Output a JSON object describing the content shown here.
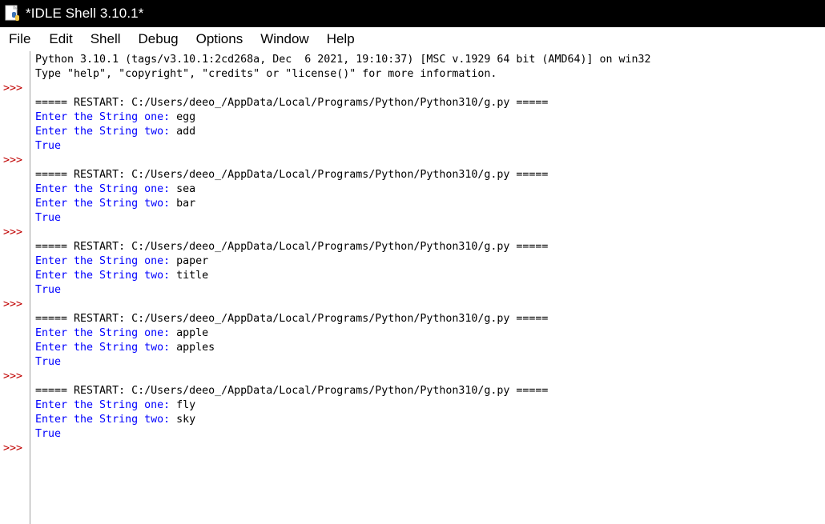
{
  "window": {
    "title": "*IDLE Shell 3.10.1*"
  },
  "menu": [
    "File",
    "Edit",
    "Shell",
    "Debug",
    "Options",
    "Window",
    "Help"
  ],
  "colors": {
    "prompt": "#c00000",
    "stdout": "#0000ff",
    "output": "#000000"
  },
  "shell": {
    "banner": [
      "Python 3.10.1 (tags/v3.10.1:2cd268a, Dec  6 2021, 19:10:37) [MSC v.1929 64 bit (AMD64)] on win32",
      "Type \"help\", \"copyright\", \"credits\" or \"license()\" for more information."
    ],
    "prompt": ">>>",
    "runs": [
      {
        "restart": "===== RESTART: C:/Users/deeo_/AppData/Local/Programs/Python/Python310/g.py =====",
        "prompt1": "Enter the String one: ",
        "input1": "egg",
        "prompt2": "Enter the String two: ",
        "input2": "add",
        "result": "True"
      },
      {
        "restart": "===== RESTART: C:/Users/deeo_/AppData/Local/Programs/Python/Python310/g.py =====",
        "prompt1": "Enter the String one: ",
        "input1": "sea",
        "prompt2": "Enter the String two: ",
        "input2": "bar",
        "result": "True"
      },
      {
        "restart": "===== RESTART: C:/Users/deeo_/AppData/Local/Programs/Python/Python310/g.py =====",
        "prompt1": "Enter the String one: ",
        "input1": "paper",
        "prompt2": "Enter the String two: ",
        "input2": "title",
        "result": "True"
      },
      {
        "restart": "===== RESTART: C:/Users/deeo_/AppData/Local/Programs/Python/Python310/g.py =====",
        "prompt1": "Enter the String one: ",
        "input1": "apple",
        "prompt2": "Enter the String two: ",
        "input2": "apples",
        "result": "True"
      },
      {
        "restart": "===== RESTART: C:/Users/deeo_/AppData/Local/Programs/Python/Python310/g.py =====",
        "prompt1": "Enter the String one: ",
        "input1": "fly",
        "prompt2": "Enter the String two: ",
        "input2": "sky",
        "result": "True"
      }
    ]
  }
}
